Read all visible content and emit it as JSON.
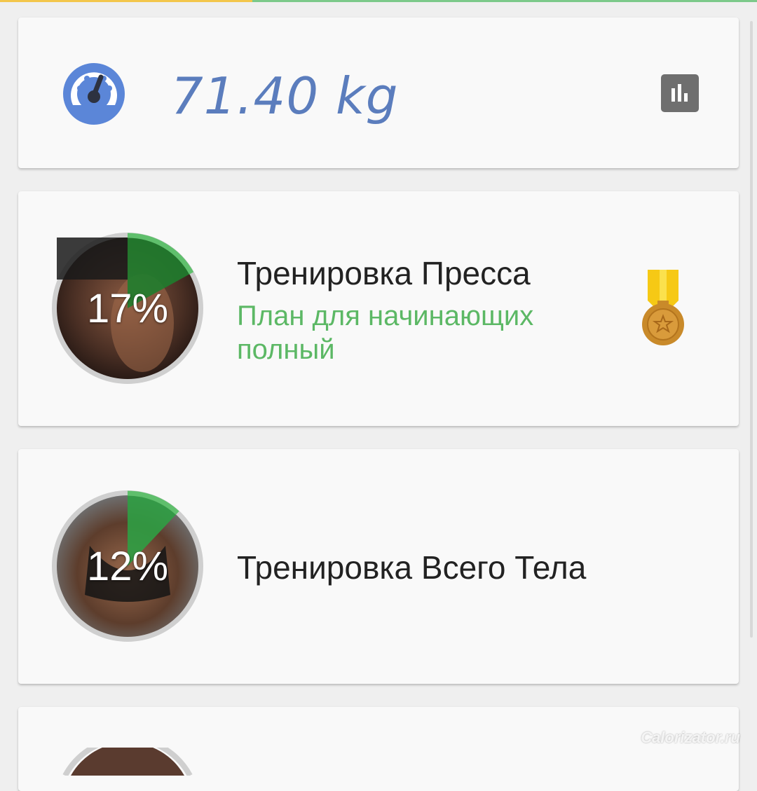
{
  "weight": {
    "value": "71.40 kg"
  },
  "workouts": [
    {
      "percent_label": "17%",
      "progress": 0.17,
      "title": "Тренировка Пресса",
      "subtitle": "План для начинающих полный"
    },
    {
      "percent_label": "12%",
      "progress": 0.12,
      "title": "Тренировка Всего Тела",
      "subtitle": ""
    }
  ],
  "icons": {
    "weight": "speedometer-icon",
    "stats": "bar-chart-icon",
    "badge": "medal-icon"
  },
  "colors": {
    "weight_text": "#5b7dbd",
    "progress": "#2f9e44",
    "subtitle": "#5cb865",
    "medal_ribbon": "#f6c915",
    "medal": "#c98a2a"
  },
  "watermark": "Calorizator.ru"
}
